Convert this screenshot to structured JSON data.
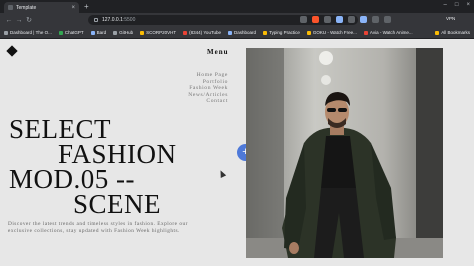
{
  "browser": {
    "tab_title": "Template",
    "url_host": "127.0.0.1",
    "url_port": ":5500",
    "vpn_label": "VPN",
    "bookmarks": [
      {
        "label": "Dashboard | The O..."
      },
      {
        "label": "ChatGPT"
      },
      {
        "label": "Bard"
      },
      {
        "label": "GitHub"
      },
      {
        "label": "SCORP20VHT"
      },
      {
        "label": "(8344) YouTube"
      },
      {
        "label": "Dashboard"
      },
      {
        "label": "Typing Practice"
      },
      {
        "label": "GOKU - Watch Free..."
      },
      {
        "label": "Avia - Watch Anime..."
      }
    ],
    "all_bookmarks_label": "All Bookmarks"
  },
  "page": {
    "menu_label": "Menu",
    "nav_links": [
      "Home Page",
      "Portfolio",
      "Fashion Week",
      "News/Articles",
      "Contact"
    ],
    "hero_lines": [
      "SELECT",
      "FASHION",
      "MOD.05 --",
      "SCENE"
    ],
    "description": "Discover the latest trends and timeless styles in fashion. Explore our exclusive collections, stay updated with Fashion Week highlights.",
    "plus_label": "+"
  },
  "colors": {
    "accent": "#4e79d9",
    "page_bg": "#e7e7e7",
    "text": "#111111"
  }
}
